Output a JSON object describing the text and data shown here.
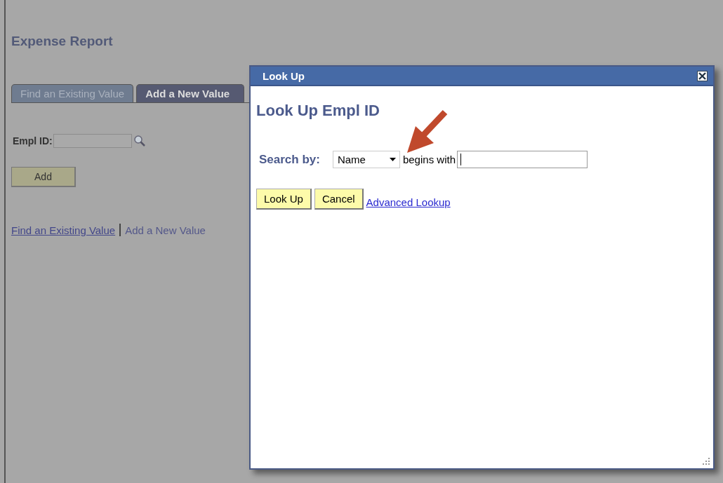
{
  "page": {
    "title": "Expense Report",
    "tabs": [
      {
        "label": "Find an Existing Value",
        "selected": false
      },
      {
        "label": "Add a New Value",
        "selected": true
      }
    ],
    "field": {
      "label": "Empl ID:"
    },
    "button": "Add",
    "links": [
      {
        "label": "Find an Existing Value",
        "selected": false
      },
      {
        "label": "Add a New Value",
        "selected": true
      }
    ]
  },
  "dialog": {
    "title": "Look Up",
    "heading": "Look Up Empl ID",
    "search_label": "Search by:",
    "search_by": "Name",
    "operator": "begins with",
    "buttons": [
      "Look Up",
      "Cancel"
    ],
    "link": "Advanced Lookup"
  }
}
